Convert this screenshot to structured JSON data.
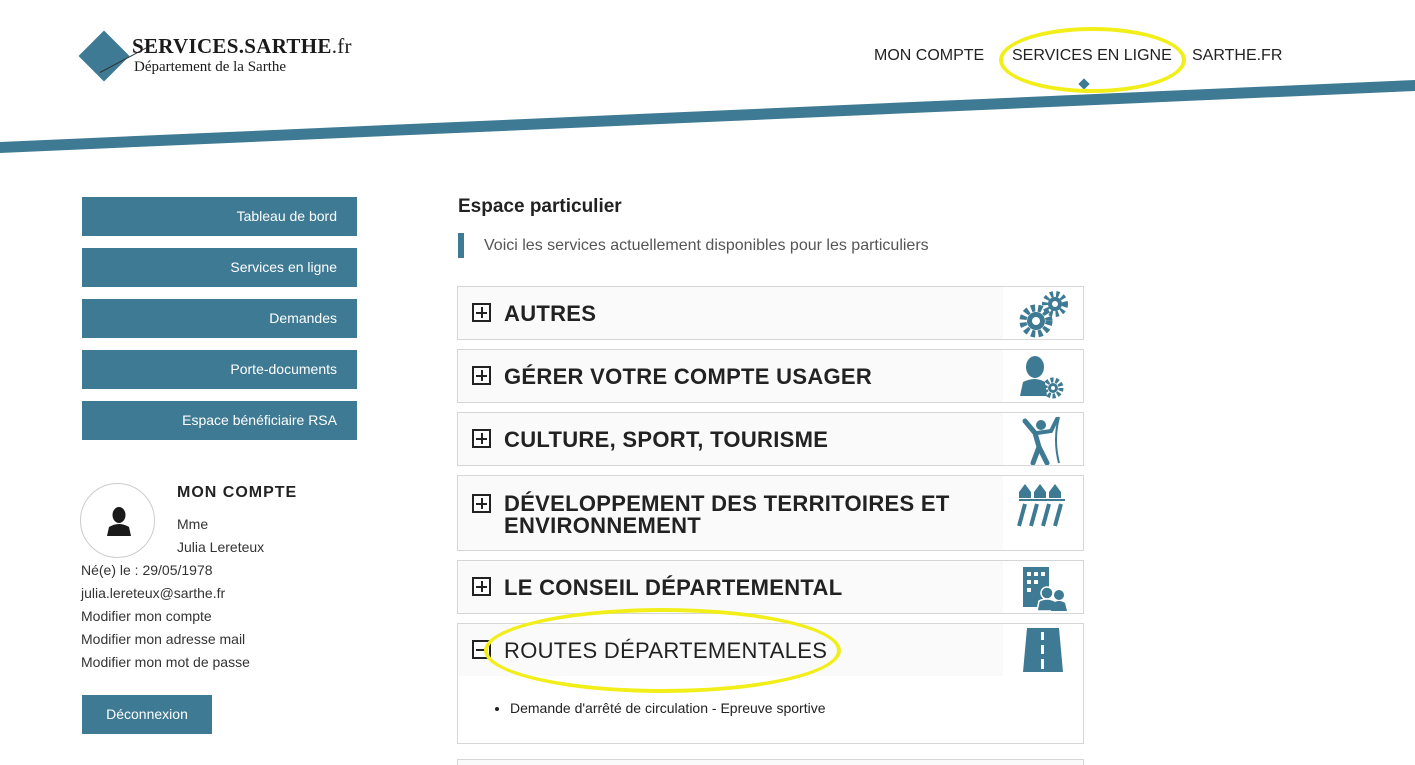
{
  "brand": {
    "title_main": "SERVICES.SARTHE",
    "title_suffix": ".fr",
    "subtitle": "Département de la Sarthe"
  },
  "topnav": {
    "account": "MON COMPTE",
    "services": "SERVICES EN LIGNE",
    "sarthe": "SARTHE.FR"
  },
  "sidebar": {
    "items": [
      {
        "label": "Tableau de bord"
      },
      {
        "label": "Services en ligne"
      },
      {
        "label": "Demandes"
      },
      {
        "label": "Porte-documents"
      },
      {
        "label": "Espace bénéficiaire RSA"
      }
    ]
  },
  "account": {
    "title": "MON COMPTE",
    "civility": "Mme",
    "name": "Julia Lereteux",
    "birth": "Né(e) le : 29/05/1978",
    "email": "julia.lereteux@sarthe.fr",
    "links": {
      "edit_account": "Modifier mon compte",
      "edit_email": "Modifier mon adresse mail",
      "edit_password": "Modifier mon mot de passe"
    },
    "logout": "Déconnexion"
  },
  "main": {
    "title": "Espace particulier",
    "subtitle": "Voici les services actuellement disponibles pour les particuliers",
    "categories": [
      {
        "label": "AUTRES",
        "icon": "gears-icon",
        "expanded": false
      },
      {
        "label": "GÉRER VOTRE COMPTE USAGER",
        "icon": "user-gear-icon",
        "expanded": false
      },
      {
        "label": "CULTURE, SPORT, TOURISME",
        "icon": "climber-icon",
        "expanded": false
      },
      {
        "label_line1": "DÉVELOPPEMENT DES TERRITOIRES ET",
        "label_line2": "ENVIRONNEMENT",
        "icon": "territory-icon",
        "expanded": false
      },
      {
        "label": "LE CONSEIL DÉPARTEMENTAL",
        "icon": "building-people-icon",
        "expanded": false
      },
      {
        "label": "ROUTES DÉPARTEMENTALES",
        "icon": "road-icon",
        "expanded": true
      }
    ],
    "routes_services": [
      "Demande d'arrêté de circulation - Epreuve sportive"
    ]
  },
  "colors": {
    "accent": "#3e7a93",
    "highlight": "#f2ee1a"
  }
}
